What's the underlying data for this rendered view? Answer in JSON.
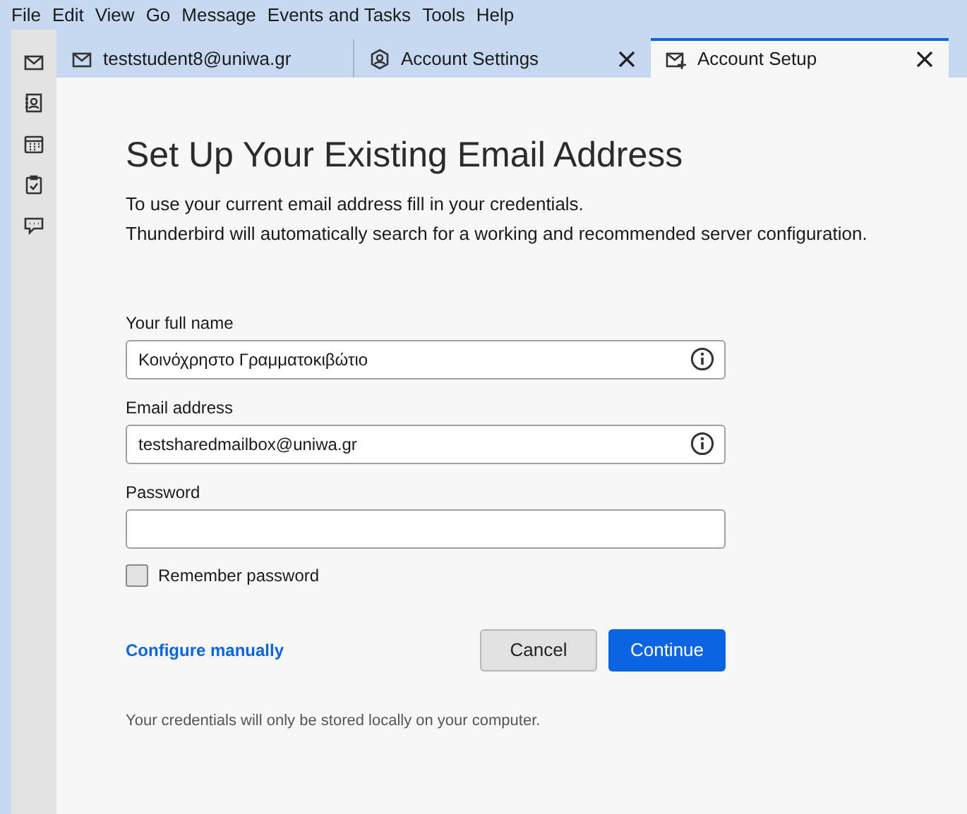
{
  "menu_bar": [
    "File",
    "Edit",
    "View",
    "Go",
    "Message",
    "Events and Tasks",
    "Tools",
    "Help"
  ],
  "spaces": [
    {
      "kind": "mail"
    },
    {
      "kind": "contacts"
    },
    {
      "kind": "calendar"
    },
    {
      "kind": "tasks"
    },
    {
      "kind": "chat"
    }
  ],
  "tabs": [
    {
      "label": "teststudent8@uniwa.gr",
      "kind": "mail",
      "selected": false,
      "closable": false
    },
    {
      "label": "Account Settings",
      "kind": "settings",
      "selected": false,
      "closable": true
    },
    {
      "label": "Account Setup",
      "kind": "setup",
      "selected": true,
      "closable": true
    }
  ],
  "title": "Set Up Your Existing Email Address",
  "intro": [
    "To use your current email address fill in your credentials.",
    "Thunderbird will automatically search for a working and recommended server configuration."
  ],
  "fields": [
    {
      "label": "Your full name",
      "value": "Κοινόχρηστο Γραμματοκιβώτιο",
      "info": true
    },
    {
      "label": "Email address",
      "value": "testsharedmailbox@uniwa.gr",
      "info": true
    },
    {
      "label": "Password",
      "info": false
    }
  ],
  "remember_password": {
    "label": "Remember password",
    "checked": false
  },
  "configure_link": "Configure manually",
  "buttons": [
    {
      "label": "Cancel",
      "primary": false
    },
    {
      "label": "Continue",
      "primary": true
    }
  ],
  "footnote": "Your credentials will only be stored locally on your computer."
}
